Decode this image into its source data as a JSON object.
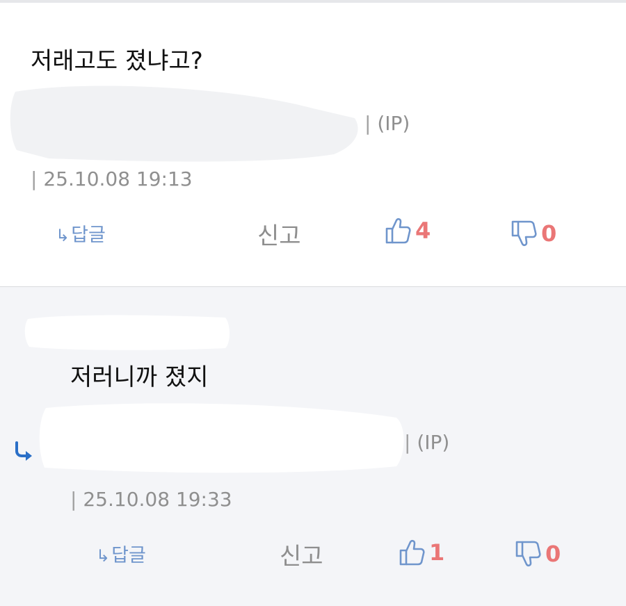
{
  "comments": [
    {
      "body": "저래고도 졌냐고?",
      "ip_label": "(IP)",
      "date": "25.10.08 19:13",
      "reply_label": "답글",
      "report_label": "신고",
      "likes": "4",
      "dislikes": "0"
    },
    {
      "body": "저러니까 졌지",
      "ip_label": "(IP)",
      "date": "25.10.08 19:33",
      "reply_label": "답글",
      "report_label": "신고",
      "likes": "1",
      "dislikes": "0"
    }
  ],
  "separator": "|",
  "reply_arrow": "↳",
  "icons": {
    "like": "thumbs-up-icon",
    "dislike": "thumbs-down-icon",
    "reply_marker": "reply-indicator-icon"
  },
  "colors": {
    "action_blue": "#6f95cc",
    "vote_count": "#ea7676",
    "meta_gray": "#8f8f8f",
    "reply_bg": "#f4f5f8"
  }
}
